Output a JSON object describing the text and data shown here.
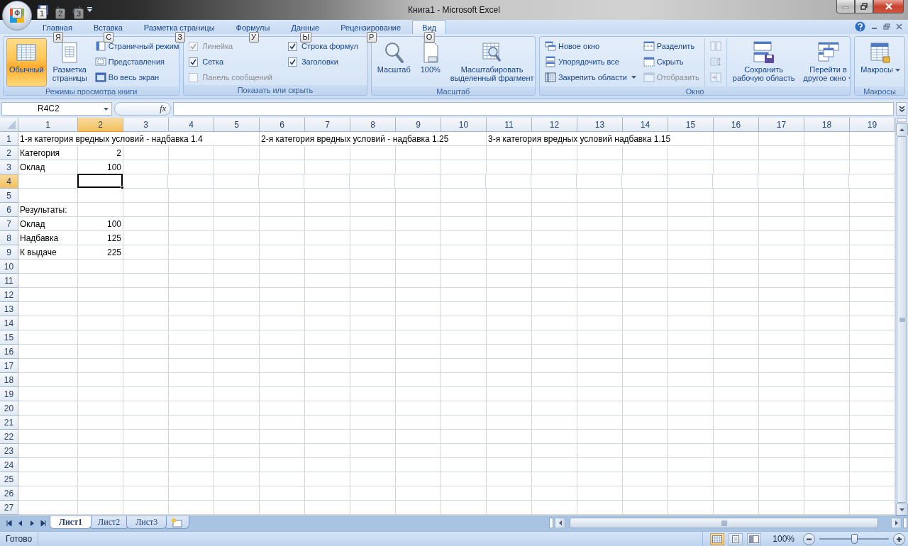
{
  "title_bar": {
    "office_keytip": "Ф",
    "quick_access": [
      {
        "keytip": "1",
        "disabled": false
      },
      {
        "keytip": "2",
        "disabled": true
      },
      {
        "keytip": "3",
        "disabled": true
      }
    ],
    "title": "Книга1 - Microsoft Excel"
  },
  "tabs": [
    {
      "label": "Главная",
      "keytip": "Я",
      "selected": false
    },
    {
      "label": "Вставка",
      "keytip": "С",
      "selected": false
    },
    {
      "label": "Разметка страницы",
      "keytip": "З",
      "selected": false
    },
    {
      "label": "Формулы",
      "keytip": "У",
      "selected": false
    },
    {
      "label": "Данные",
      "keytip": "Ы",
      "selected": false
    },
    {
      "label": "Рецензирование",
      "keytip": "Р",
      "selected": false
    },
    {
      "label": "Вид",
      "keytip": "О",
      "selected": true
    }
  ],
  "ribbon": {
    "groups": [
      {
        "title": "Режимы просмотра книги",
        "columns": [
          [
            {
              "kind": "large",
              "label": "Обычный",
              "selected": true
            }
          ],
          [
            {
              "kind": "large",
              "label": "Разметка\nстраницы",
              "selected": false
            }
          ],
          [
            {
              "kind": "small",
              "label": "Страничный режим"
            },
            {
              "kind": "small",
              "label": "Представления"
            },
            {
              "kind": "small",
              "label": "Во весь экран"
            }
          ]
        ]
      },
      {
        "title": "Показать или скрыть",
        "columns": [
          [
            {
              "kind": "check",
              "label": "Линейка",
              "checked": true,
              "disabled": true
            },
            {
              "kind": "check",
              "label": "Сетка",
              "checked": true,
              "disabled": false
            },
            {
              "kind": "check",
              "label": "Панель сообщений",
              "checked": false,
              "disabled": true
            }
          ],
          [
            {
              "kind": "check",
              "label": "Строка формул",
              "checked": true,
              "disabled": false
            },
            {
              "kind": "check",
              "label": "Заголовки",
              "checked": true,
              "disabled": false
            }
          ]
        ]
      },
      {
        "title": "Масштаб",
        "columns": [
          [
            {
              "kind": "large",
              "label": "Масштаб",
              "selected": false
            }
          ],
          [
            {
              "kind": "large",
              "label": "100%",
              "selected": false
            }
          ],
          [
            {
              "kind": "large",
              "label": "Масштабировать\nвыделенный фрагмент",
              "selected": false
            }
          ]
        ]
      },
      {
        "title": "Окно",
        "columns": [
          [
            {
              "kind": "small",
              "label": "Новое окно"
            },
            {
              "kind": "small",
              "label": "Упорядочить все"
            },
            {
              "kind": "small",
              "label": "Закрепить области",
              "menu": true
            }
          ],
          [
            {
              "kind": "small",
              "label": "Разделить"
            },
            {
              "kind": "small",
              "label": "Скрыть"
            },
            {
              "kind": "small",
              "label": "Отобразить",
              "disabled": true
            }
          ],
          [
            {
              "kind": "icon",
              "disabled": true
            },
            {
              "kind": "icon",
              "disabled": true
            },
            {
              "kind": "icon",
              "disabled": true
            }
          ],
          [
            {
              "kind": "large",
              "label": "Сохранить\nрабочую область",
              "selected": false
            }
          ],
          [
            {
              "kind": "large",
              "label": "Перейти в\nдругое окно",
              "selected": false,
              "menu": true
            }
          ]
        ]
      },
      {
        "title": "Макросы",
        "columns": [
          [
            {
              "kind": "large",
              "label": "Макросы",
              "selected": false,
              "menu": true
            }
          ]
        ]
      }
    ]
  },
  "formula_bar": {
    "name_box": "R4C2",
    "function_label": "fx"
  },
  "grid": {
    "columns": [
      {
        "header": "1",
        "selected": false
      },
      {
        "header": "2",
        "selected": true
      },
      {
        "header": "3",
        "selected": false
      },
      {
        "header": "4",
        "selected": false
      },
      {
        "header": "5",
        "selected": false
      },
      {
        "header": "6",
        "selected": false
      },
      {
        "header": "7",
        "selected": false
      },
      {
        "header": "8",
        "selected": false
      },
      {
        "header": "9",
        "selected": false
      },
      {
        "header": "10",
        "selected": false
      },
      {
        "header": "11",
        "selected": false
      },
      {
        "header": "12",
        "selected": false
      },
      {
        "header": "13",
        "selected": false
      },
      {
        "header": "14",
        "selected": false
      },
      {
        "header": "15",
        "selected": false
      },
      {
        "header": "16",
        "selected": false
      },
      {
        "header": "17",
        "selected": false
      },
      {
        "header": "18",
        "selected": false
      },
      {
        "header": "19",
        "selected": false
      }
    ],
    "rows": [
      {
        "header": "1",
        "selected": false,
        "cells": [
          {
            "text": "1-я категория вредных условий - надбавка 1.4",
            "kind": "text"
          },
          null,
          null,
          null,
          null,
          {
            "text": "2-я категория вредных условий - надбавка 1.25",
            "kind": "text"
          },
          null,
          null,
          null,
          null,
          {
            "text": "3-я категория вредных условий надбавка 1.15",
            "kind": "text"
          }
        ]
      },
      {
        "header": "2",
        "selected": false,
        "cells": [
          {
            "text": "Категория",
            "kind": "text"
          },
          {
            "text": "2",
            "kind": "number"
          }
        ]
      },
      {
        "header": "3",
        "selected": false,
        "cells": [
          {
            "text": "Оклад",
            "kind": "text"
          },
          {
            "text": "100",
            "kind": "number"
          }
        ]
      },
      {
        "header": "4",
        "selected": true
      },
      {
        "header": "5",
        "selected": false
      },
      {
        "header": "6",
        "selected": false,
        "cells": [
          {
            "text": "Результаты:",
            "kind": "text"
          }
        ]
      },
      {
        "header": "7",
        "selected": false,
        "cells": [
          {
            "text": "Оклад",
            "kind": "text"
          },
          {
            "text": "100",
            "kind": "number"
          }
        ]
      },
      {
        "header": "8",
        "selected": false,
        "cells": [
          {
            "text": "Надбавка",
            "kind": "text"
          },
          {
            "text": "125",
            "kind": "number"
          }
        ]
      },
      {
        "header": "9",
        "selected": false,
        "cells": [
          {
            "text": "К выдаче",
            "kind": "text"
          },
          {
            "text": "225",
            "kind": "number"
          }
        ]
      },
      {
        "header": "10",
        "selected": false
      },
      {
        "header": "11",
        "selected": false
      },
      {
        "header": "12",
        "selected": false
      },
      {
        "header": "13",
        "selected": false
      },
      {
        "header": "14",
        "selected": false
      },
      {
        "header": "15",
        "selected": false
      },
      {
        "header": "16",
        "selected": false
      },
      {
        "header": "17",
        "selected": false
      },
      {
        "header": "18",
        "selected": false
      },
      {
        "header": "19",
        "selected": false
      },
      {
        "header": "20",
        "selected": false
      },
      {
        "header": "21",
        "selected": false
      },
      {
        "header": "22",
        "selected": false
      },
      {
        "header": "23",
        "selected": false
      },
      {
        "header": "24",
        "selected": false
      },
      {
        "header": "25",
        "selected": false
      },
      {
        "header": "26",
        "selected": false
      },
      {
        "header": "27",
        "selected": false
      }
    ]
  },
  "sheet_tabs": [
    {
      "label": "Лист1",
      "selected": true
    },
    {
      "label": "Лист2",
      "selected": false
    },
    {
      "label": "Лист3",
      "selected": false
    }
  ],
  "status_bar": {
    "text": "Готово",
    "views": [
      {
        "selected": true
      },
      {
        "selected": false
      },
      {
        "selected": false
      }
    ],
    "zoom": "100%",
    "zoom_slider": {
      "level": 0.5
    }
  }
}
